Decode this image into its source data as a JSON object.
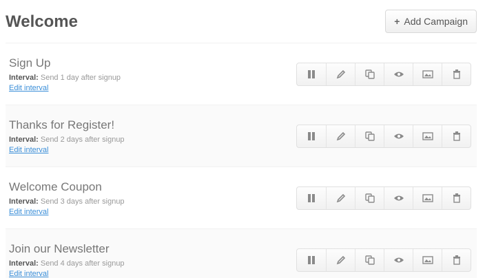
{
  "header": {
    "title": "Welcome",
    "add_button": {
      "icon": "plus-icon",
      "label": "Add Campaign"
    }
  },
  "campaigns": [
    {
      "title": "Sign Up",
      "interval_label": "Interval:",
      "interval_value": "Send 1 day after signup",
      "edit_label": "Edit interval"
    },
    {
      "title": "Thanks for Register!",
      "interval_label": "Interval:",
      "interval_value": "Send 2 days after signup",
      "edit_label": "Edit interval"
    },
    {
      "title": "Welcome Coupon",
      "interval_label": "Interval:",
      "interval_value": "Send 3 days after signup",
      "edit_label": "Edit interval"
    },
    {
      "title": "Join our Newsletter",
      "interval_label": "Interval:",
      "interval_value": "Send 4 days after signup",
      "edit_label": "Edit interval"
    }
  ],
  "row_actions": [
    "pause-icon",
    "pencil-icon",
    "copy-icon",
    "eye-icon",
    "image-icon",
    "trash-icon"
  ],
  "colors": {
    "link": "#3a8ed8",
    "title": "#555555",
    "icon": "#8a8a8a"
  }
}
